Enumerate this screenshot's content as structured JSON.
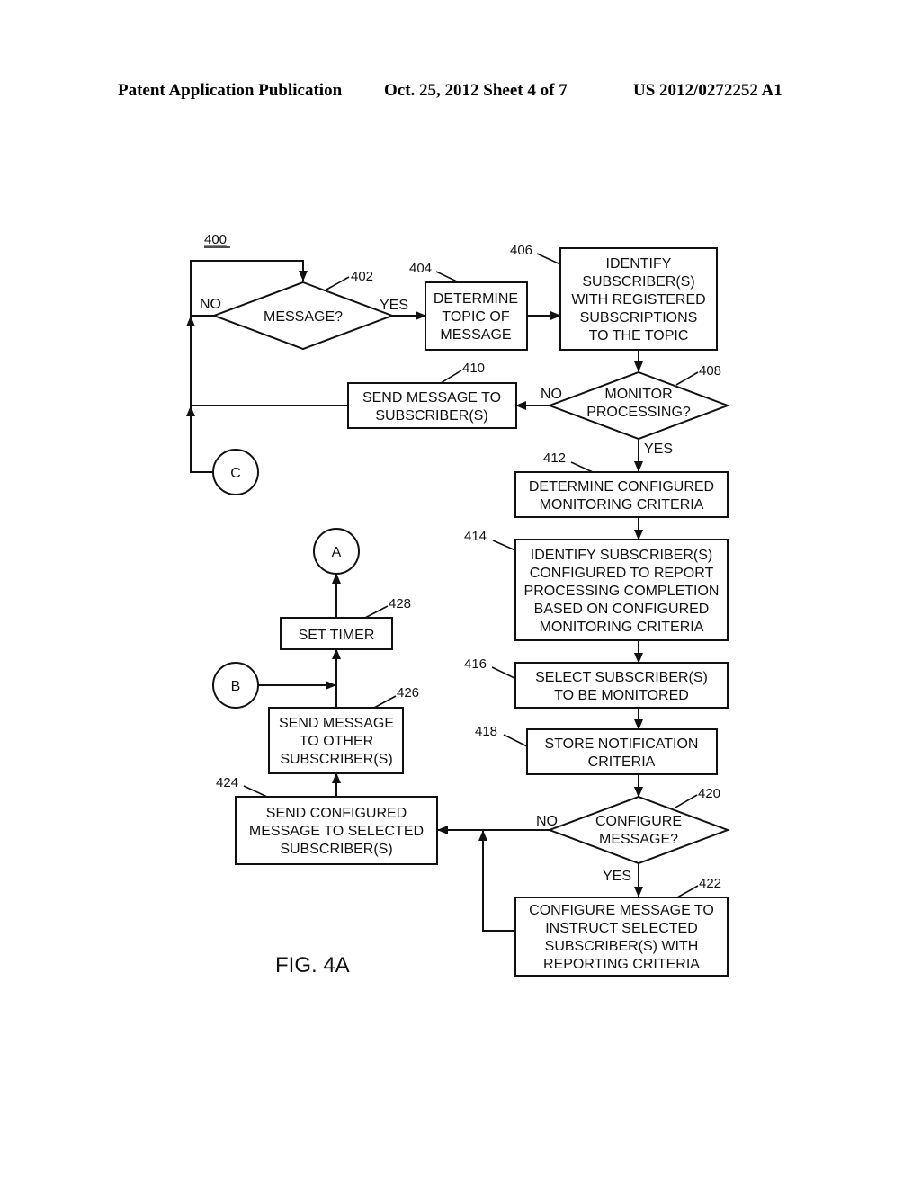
{
  "header": {
    "publication": "Patent Application Publication",
    "date_sheet": "Oct. 25, 2012   Sheet 4 of 7",
    "number": "US 2012/0272252 A1"
  },
  "figure": {
    "id": "400",
    "caption": "FIG. 4A"
  },
  "nodes": {
    "n402": {
      "ref": "402",
      "type": "decision",
      "lines": [
        "MESSAGE?"
      ]
    },
    "n404": {
      "ref": "404",
      "type": "process",
      "lines": [
        "DETERMINE",
        "TOPIC OF",
        "MESSAGE"
      ]
    },
    "n406": {
      "ref": "406",
      "type": "process",
      "lines": [
        "IDENTIFY",
        "SUBSCRIBER(S)",
        "WITH REGISTERED",
        "SUBSCRIPTIONS",
        "TO THE TOPIC"
      ]
    },
    "n408": {
      "ref": "408",
      "type": "decision",
      "lines": [
        "MONITOR",
        "PROCESSING?"
      ]
    },
    "n410": {
      "ref": "410",
      "type": "process",
      "lines": [
        "SEND MESSAGE TO",
        "SUBSCRIBER(S)"
      ]
    },
    "n412": {
      "ref": "412",
      "type": "process",
      "lines": [
        "DETERMINE CONFIGURED",
        "MONITORING CRITERIA"
      ]
    },
    "n414": {
      "ref": "414",
      "type": "process",
      "lines": [
        "IDENTIFY SUBSCRIBER(S)",
        "CONFIGURED TO REPORT",
        "PROCESSING COMPLETION",
        "BASED ON CONFIGURED",
        "MONITORING CRITERIA"
      ]
    },
    "n416": {
      "ref": "416",
      "type": "process",
      "lines": [
        "SELECT SUBSCRIBER(S)",
        "TO BE MONITORED"
      ]
    },
    "n418": {
      "ref": "418",
      "type": "process",
      "lines": [
        "STORE NOTIFICATION",
        "CRITERIA"
      ]
    },
    "n420": {
      "ref": "420",
      "type": "decision",
      "lines": [
        "CONFIGURE",
        "MESSAGE?"
      ]
    },
    "n422": {
      "ref": "422",
      "type": "process",
      "lines": [
        "CONFIGURE MESSAGE TO",
        "INSTRUCT SELECTED",
        "SUBSCRIBER(S) WITH",
        "REPORTING CRITERIA"
      ]
    },
    "n424": {
      "ref": "424",
      "type": "process",
      "lines": [
        "SEND CONFIGURED",
        "MESSAGE TO SELECTED",
        "SUBSCRIBER(S)"
      ]
    },
    "n426": {
      "ref": "426",
      "type": "process",
      "lines": [
        "SEND MESSAGE",
        "TO OTHER",
        "SUBSCRIBER(S)"
      ]
    },
    "n428": {
      "ref": "428",
      "type": "process",
      "lines": [
        "SET TIMER"
      ]
    }
  },
  "connectors": {
    "A": "A",
    "B": "B",
    "C": "C"
  },
  "edge_labels": {
    "n402_no": "NO",
    "n402_yes": "YES",
    "n408_no": "NO",
    "n408_yes": "YES",
    "n420_no": "NO",
    "n420_yes": "YES"
  }
}
